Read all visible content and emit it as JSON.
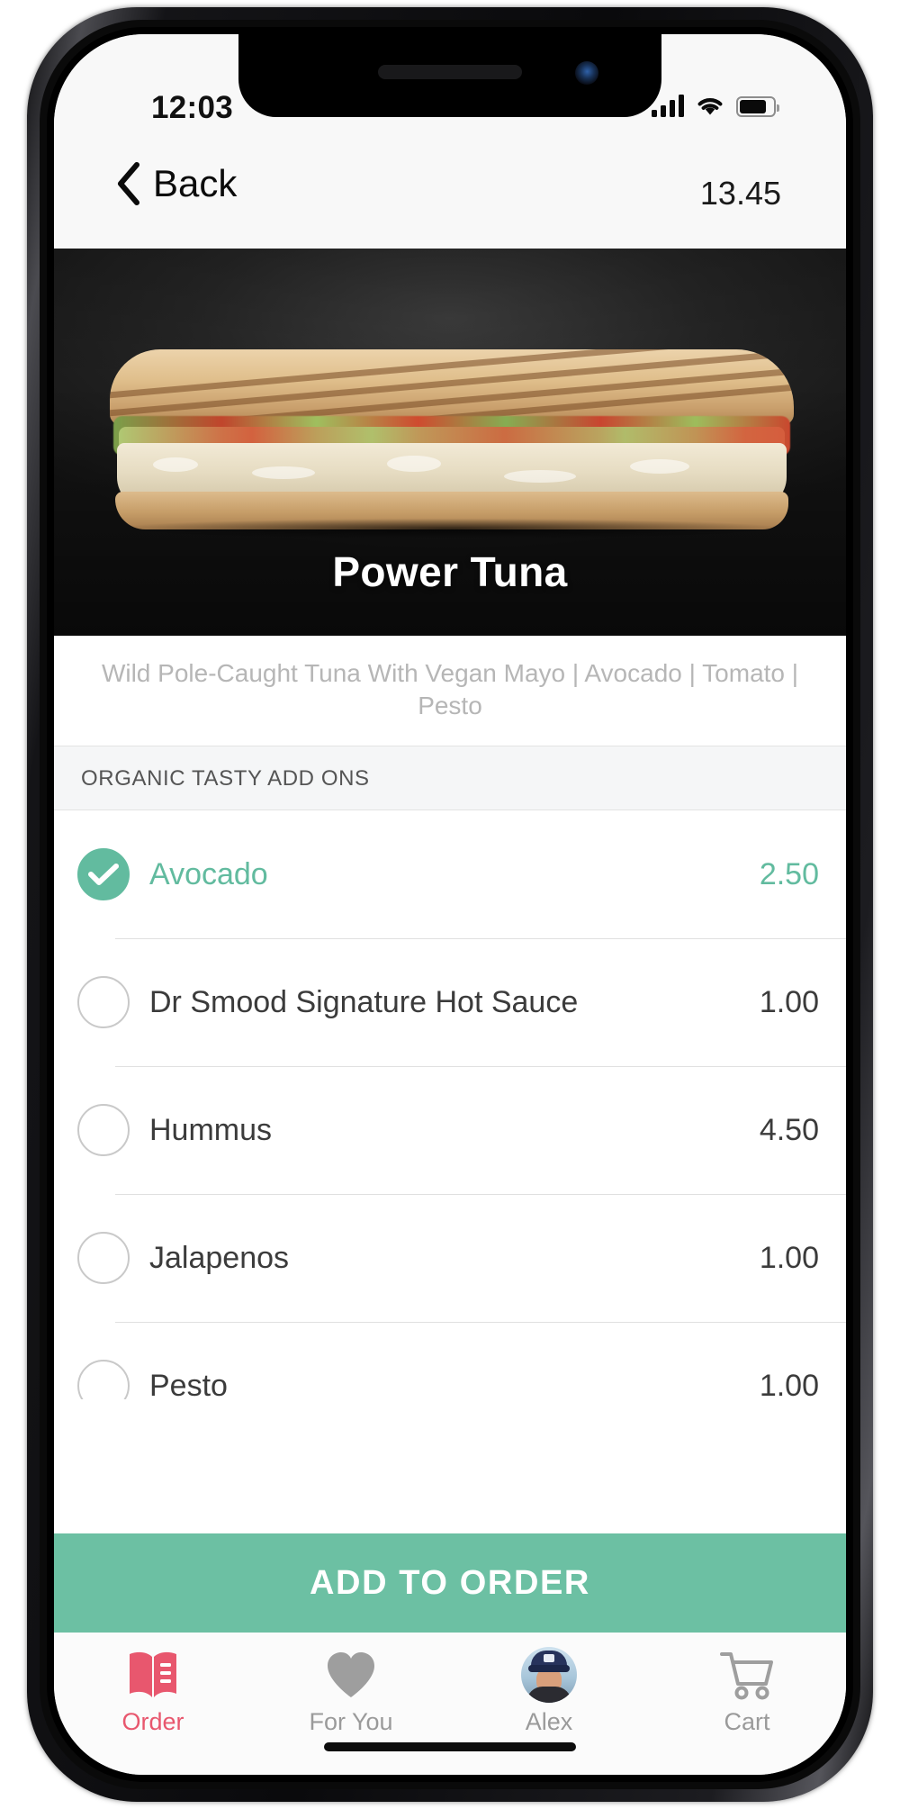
{
  "status_bar": {
    "time": "12:03",
    "signal_icon": "cellular-signal-icon",
    "wifi_icon": "wifi-icon",
    "battery_icon": "battery-icon",
    "battery_level": "72%"
  },
  "nav_bar": {
    "back_label": "Back",
    "back_icon": "chevron-left-icon",
    "price": "13.45"
  },
  "product": {
    "title": "Power Tuna",
    "description": "Wild Pole-Caught Tuna With Vegan Mayo | Avocado | Tomato | Pesto",
    "image_alt": "power-tuna-panini-photo"
  },
  "addons_section": {
    "header": "ORGANIC TASTY ADD ONS",
    "items": [
      {
        "label": "Avocado",
        "price": "2.50",
        "selected": true
      },
      {
        "label": "Dr Smood Signature Hot Sauce",
        "price": "1.00",
        "selected": false
      },
      {
        "label": "Hummus",
        "price": "4.50",
        "selected": false
      },
      {
        "label": "Jalapenos",
        "price": "1.00",
        "selected": false
      },
      {
        "label": "Pesto",
        "price": "1.00",
        "selected": false
      }
    ]
  },
  "cta": {
    "label": "ADD TO ORDER"
  },
  "tab_bar": {
    "tabs": [
      {
        "label": "Order",
        "icon": "open-book-icon",
        "active": true
      },
      {
        "label": "For You",
        "icon": "heart-icon",
        "active": false
      },
      {
        "label": "Alex",
        "icon": "user-avatar-icon",
        "active": false
      },
      {
        "label": "Cart",
        "icon": "shopping-cart-icon",
        "active": false
      }
    ]
  },
  "colors": {
    "accent_green": "#62bb9f",
    "cta_green": "#6cc0a3",
    "active_tab_red": "#e8576e",
    "muted_text": "#9a9a9a",
    "description_text": "#b6b6b6"
  }
}
